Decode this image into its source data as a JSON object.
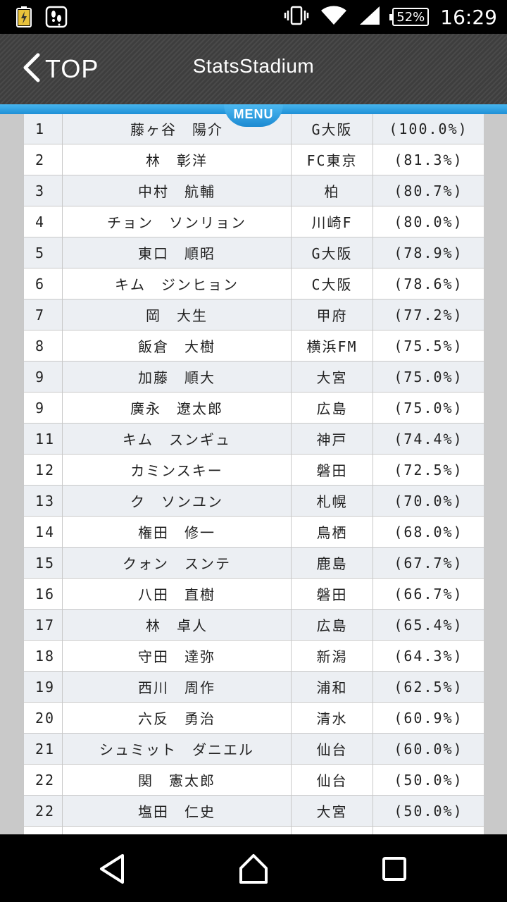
{
  "status_bar": {
    "battery": "52%",
    "time": "16:29"
  },
  "app": {
    "back_label": "TOP",
    "title": "StatsStadium",
    "menu_label": "MENU"
  },
  "table": {
    "rows": [
      {
        "rank": "1",
        "name": "藤ヶ谷　陽介",
        "team": "G大阪",
        "pct": "(100.0%)"
      },
      {
        "rank": "2",
        "name": "林　彰洋",
        "team": "FC東京",
        "pct": "(81.3%)"
      },
      {
        "rank": "3",
        "name": "中村　航輔",
        "team": "柏",
        "pct": "(80.7%)"
      },
      {
        "rank": "4",
        "name": "チョン　ソンリョン",
        "team": "川崎F",
        "pct": "(80.0%)"
      },
      {
        "rank": "5",
        "name": "東口　順昭",
        "team": "G大阪",
        "pct": "(78.9%)"
      },
      {
        "rank": "6",
        "name": "キム　ジンヒョン",
        "team": "C大阪",
        "pct": "(78.6%)"
      },
      {
        "rank": "7",
        "name": "岡　大生",
        "team": "甲府",
        "pct": "(77.2%)"
      },
      {
        "rank": "8",
        "name": "飯倉　大樹",
        "team": "横浜FM",
        "pct": "(75.5%)"
      },
      {
        "rank": "9",
        "name": "加藤　順大",
        "team": "大宮",
        "pct": "(75.0%)"
      },
      {
        "rank": "9",
        "name": "廣永　遼太郎",
        "team": "広島",
        "pct": "(75.0%)"
      },
      {
        "rank": "11",
        "name": "キム　スンギュ",
        "team": "神戸",
        "pct": "(74.4%)"
      },
      {
        "rank": "12",
        "name": "カミンスキー",
        "team": "磐田",
        "pct": "(72.5%)"
      },
      {
        "rank": "13",
        "name": "ク　ソンユン",
        "team": "札幌",
        "pct": "(70.0%)"
      },
      {
        "rank": "14",
        "name": "権田　修一",
        "team": "鳥栖",
        "pct": "(68.0%)"
      },
      {
        "rank": "15",
        "name": "クォン　スンテ",
        "team": "鹿島",
        "pct": "(67.7%)"
      },
      {
        "rank": "16",
        "name": "八田　直樹",
        "team": "磐田",
        "pct": "(66.7%)"
      },
      {
        "rank": "17",
        "name": "林　卓人",
        "team": "広島",
        "pct": "(65.4%)"
      },
      {
        "rank": "18",
        "name": "守田　達弥",
        "team": "新潟",
        "pct": "(64.3%)"
      },
      {
        "rank": "19",
        "name": "西川　周作",
        "team": "浦和",
        "pct": "(62.5%)"
      },
      {
        "rank": "20",
        "name": "六反　勇治",
        "team": "清水",
        "pct": "(60.9%)"
      },
      {
        "rank": "21",
        "name": "シュミット　ダニエル",
        "team": "仙台",
        "pct": "(60.0%)"
      },
      {
        "rank": "22",
        "name": "関　憲太郎",
        "team": "仙台",
        "pct": "(50.0%)"
      },
      {
        "rank": "22",
        "name": "塩田　仁史",
        "team": "大宮",
        "pct": "(50.0%)"
      },
      {
        "rank": "",
        "name": "",
        "team": "",
        "pct": ""
      }
    ]
  },
  "colors": {
    "accent_blue": "#1e8fd6",
    "header_bg": "#444444",
    "row_alt": "#eceff3"
  },
  "icons": {
    "status_left": [
      "charging-battery-icon",
      "app-notification-icon"
    ],
    "status_right": [
      "vibrate-icon",
      "wifi-icon",
      "signal-icon"
    ],
    "nav": [
      "back-icon",
      "home-icon",
      "recents-icon"
    ]
  }
}
